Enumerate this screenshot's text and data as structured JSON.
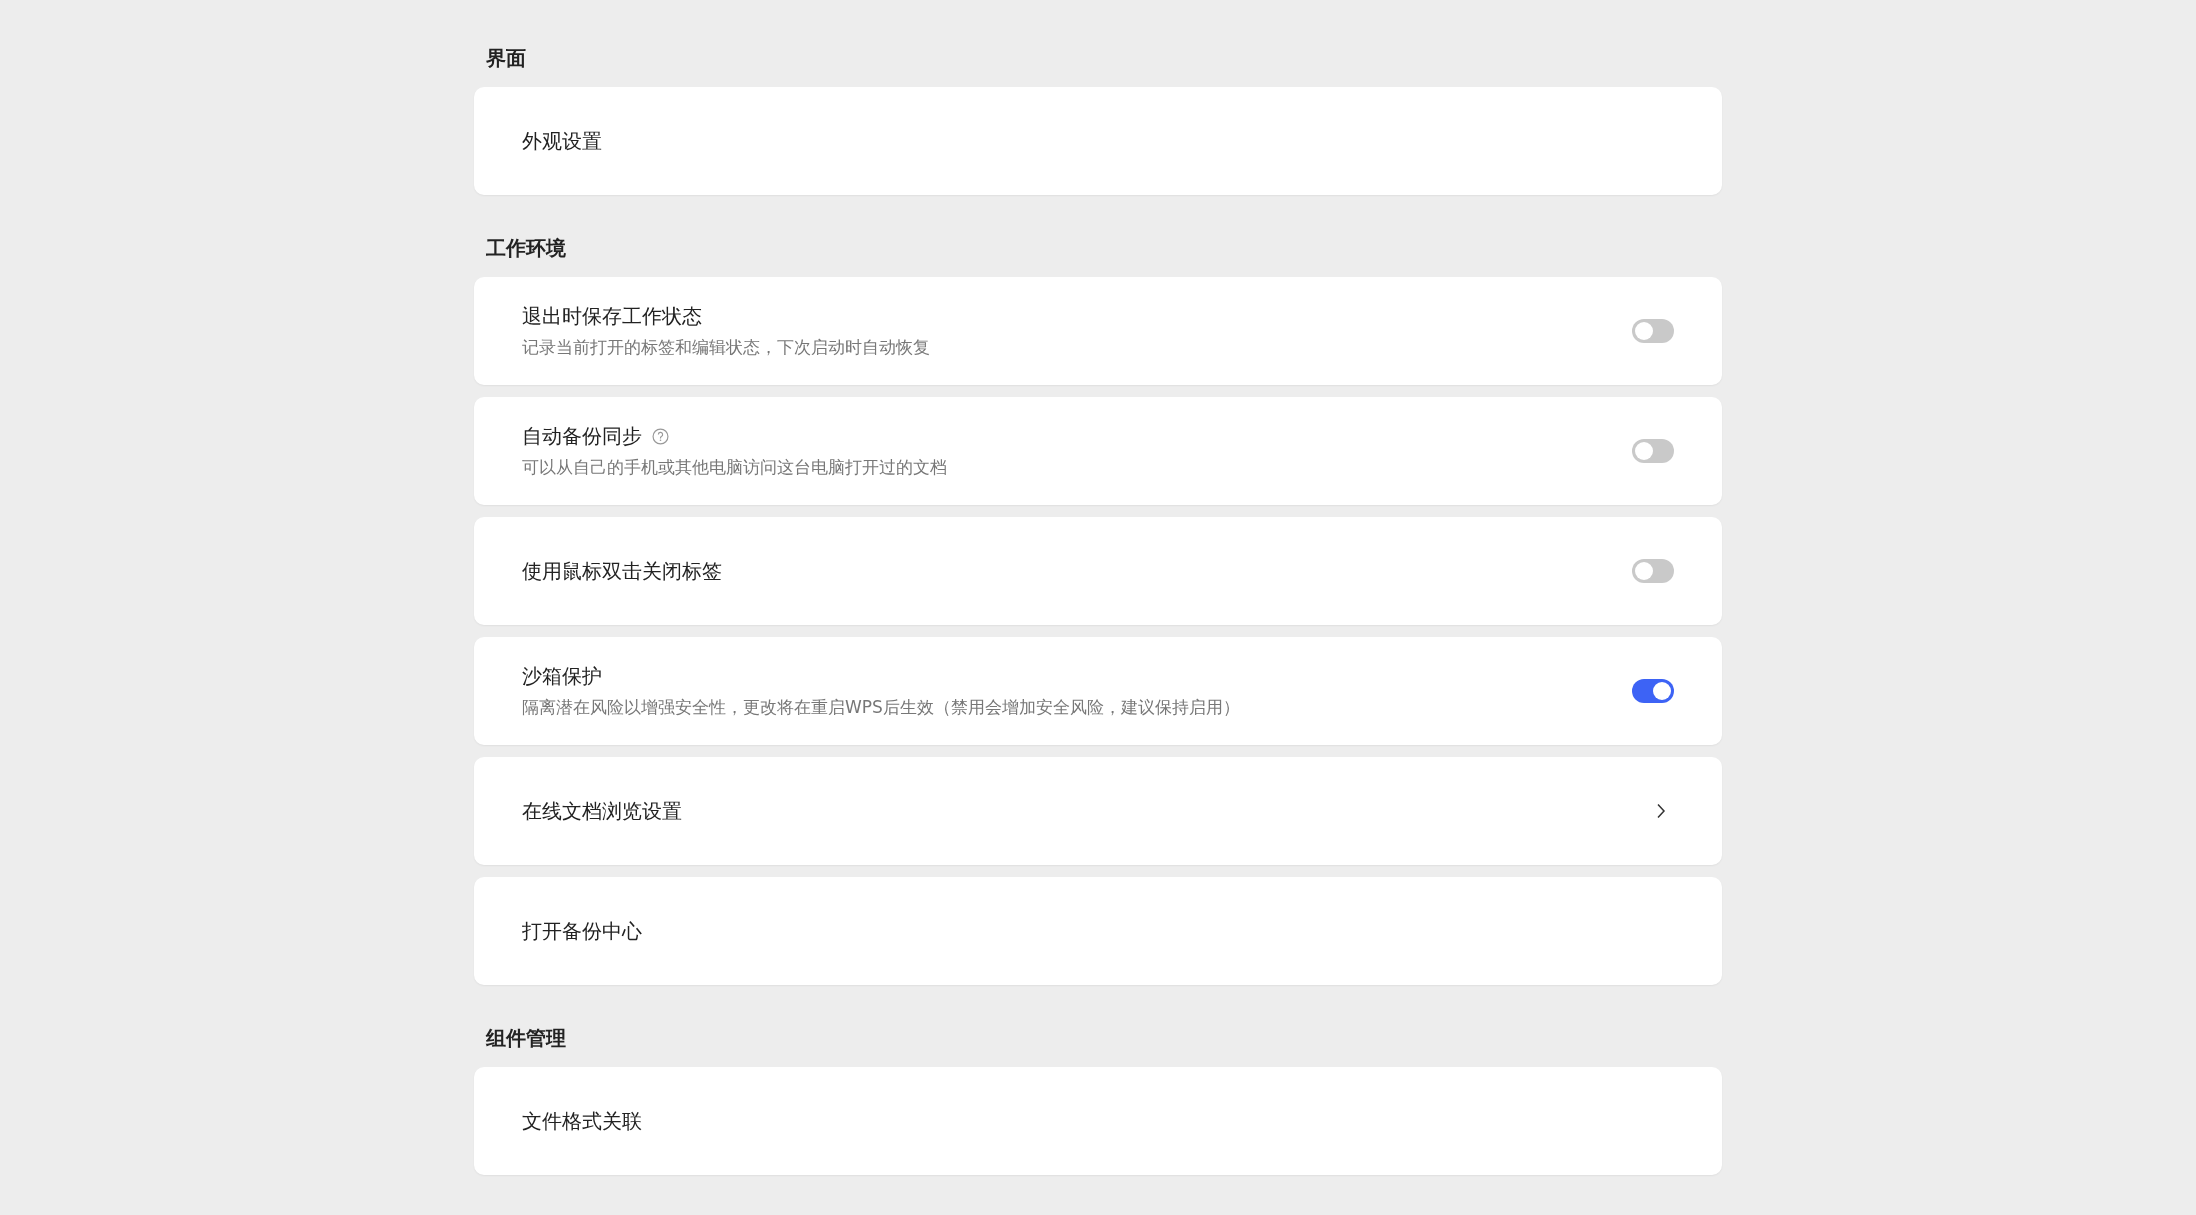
{
  "sections": [
    {
      "title": "界面",
      "items": [
        {
          "kind": "plain",
          "label": "外观设置"
        }
      ]
    },
    {
      "title": "工作环境",
      "items": [
        {
          "kind": "toggle",
          "label": "退出时保存工作状态",
          "description": "记录当前打开的标签和编辑状态，下次启动时自动恢复",
          "on": false
        },
        {
          "kind": "toggle",
          "label": "自动备份同步",
          "help": true,
          "description": "可以从自己的手机或其他电脑访问这台电脑打开过的文档",
          "on": false
        },
        {
          "kind": "toggle",
          "label": "使用鼠标双击关闭标签",
          "on": false
        },
        {
          "kind": "toggle",
          "label": "沙箱保护",
          "description": "隔离潜在风险以增强安全性，更改将在重启WPS后生效（禁用会增加安全风险，建议保持启用）",
          "on": true
        },
        {
          "kind": "link",
          "label": "在线文档浏览设置"
        },
        {
          "kind": "plain",
          "label": "打开备份中心"
        }
      ]
    },
    {
      "title": "组件管理",
      "items": [
        {
          "kind": "plain",
          "label": "文件格式关联"
        }
      ]
    }
  ]
}
